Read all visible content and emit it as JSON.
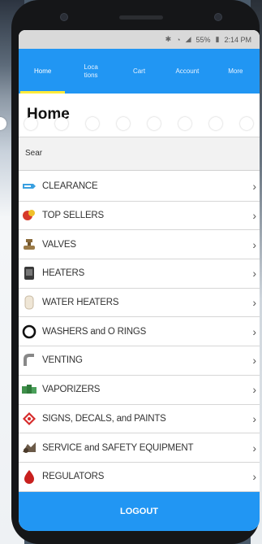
{
  "status": {
    "battery": "55%",
    "time": "2:14 PM"
  },
  "nav": {
    "tabs": [
      {
        "label": "Home"
      },
      {
        "label": "Loca\ntions"
      },
      {
        "label": "Cart"
      },
      {
        "label": "Account"
      },
      {
        "label": "More"
      }
    ],
    "active_tab": "Home",
    "accent": "#2196f3",
    "indicator": "#ffeb3b"
  },
  "page": {
    "title": "Home"
  },
  "search": {
    "value": "Sear"
  },
  "categories": [
    {
      "label": "CLEARANCE",
      "icon": "clearance-tag-icon"
    },
    {
      "label": "TOP SELLERS",
      "icon": "top-sellers-icon"
    },
    {
      "label": "VALVES",
      "icon": "valve-icon"
    },
    {
      "label": "HEATERS",
      "icon": "heater-icon"
    },
    {
      "label": "WATER HEATERS",
      "icon": "water-heater-icon"
    },
    {
      "label": "WASHERS and O RINGS",
      "icon": "o-ring-icon"
    },
    {
      "label": "VENTING",
      "icon": "vent-pipe-icon"
    },
    {
      "label": "VAPORIZERS",
      "icon": "vaporizer-icon"
    },
    {
      "label": "SIGNS, DECALS, and PAINTS",
      "icon": "warning-sign-icon"
    },
    {
      "label": "SERVICE and SAFETY EQUIPMENT",
      "icon": "safety-equipment-icon"
    },
    {
      "label": "REGULATORS",
      "icon": "regulator-icon"
    }
  ],
  "footer": {
    "logout_label": "LOGOUT"
  }
}
